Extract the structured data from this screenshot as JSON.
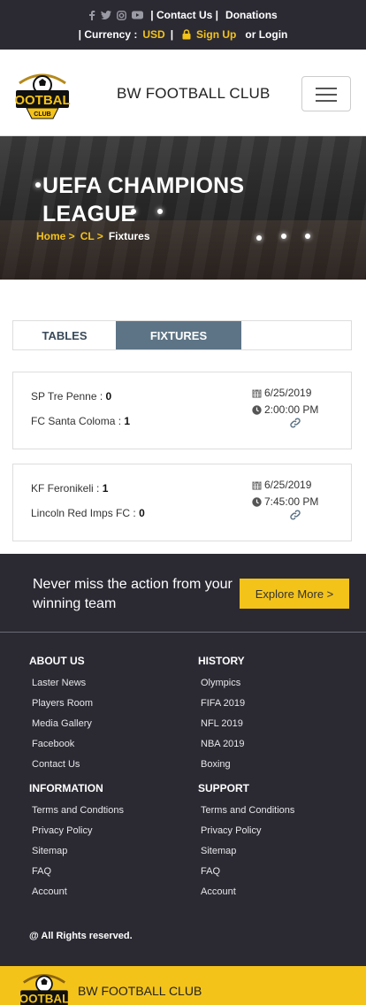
{
  "topbar": {
    "social_icons": [
      "facebook-icon",
      "twitter-icon",
      "instagram-icon",
      "youtube-icon"
    ],
    "contact": "| Contact Us |",
    "donations": "Donations",
    "currency_label": "| Currency :",
    "currency_value": "USD",
    "separator": "|",
    "signup": "Sign Up",
    "login": "or Login"
  },
  "header": {
    "club_name": "BW FOOTBALL CLUB",
    "logo_text": "FOOTBALL",
    "logo_sub": "CLUB"
  },
  "hero": {
    "title": "UEFA CHAMPIONS LEAGUE",
    "breadcrumb": [
      "Home >",
      "CL >",
      "Fixtures"
    ]
  },
  "tabs": [
    {
      "label": "TABLES",
      "active": false
    },
    {
      "label": "FIXTURES",
      "active": true
    }
  ],
  "fixtures": [
    {
      "home": "SP Tre Penne :",
      "home_score": "0",
      "away": "FC Santa Coloma :",
      "away_score": "1",
      "date": "6/25/2019",
      "time": "2:00:00 PM"
    },
    {
      "home": "KF Feronikeli :",
      "home_score": "1",
      "away": "Lincoln Red Imps FC :",
      "away_score": "0",
      "date": "6/25/2019",
      "time": "7:45:00 PM"
    }
  ],
  "footer": {
    "cta_text": "Never miss the action from your winning team",
    "explore_label": "Explore More >",
    "about": {
      "title": "ABOUT US",
      "items": [
        "Laster News",
        "Players Room",
        "Media Gallery",
        "Facebook",
        "Contact Us"
      ]
    },
    "history": {
      "title": "HISTORY",
      "items": [
        "Olympics",
        "FIFA 2019",
        "NFL 2019",
        "NBA 2019",
        "Boxing"
      ]
    },
    "information": {
      "title": "INFORMATION",
      "items": [
        "Terms and Condtions",
        "Privacy Policy",
        "Sitemap",
        "FAQ",
        "Account"
      ]
    },
    "support": {
      "title": "SUPPORT",
      "items": [
        "Terms and Conditions",
        "Privacy Policy",
        "Sitemap",
        "FAQ",
        "Account"
      ]
    },
    "rights": "@ All Rights reserved."
  },
  "bottom": {
    "club_name": "BW FOOTBALL CLUB"
  },
  "colors": {
    "accent": "#f4c31a",
    "dark": "#2b2a33",
    "tab_active": "#5d7486"
  }
}
